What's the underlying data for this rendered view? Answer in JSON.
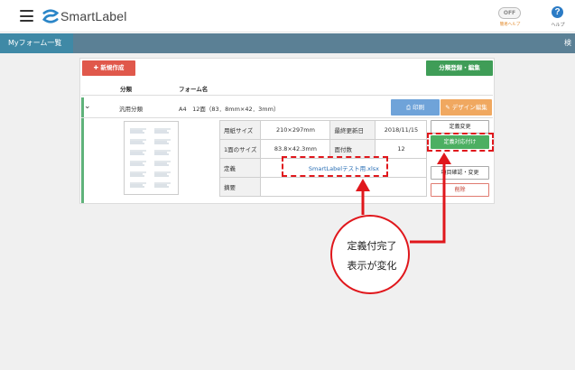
{
  "header": {
    "brand": "SmartLabel",
    "toggle_state": "OFF",
    "toggle_caption": "簡易ヘルプ",
    "help_label": "ヘルプ"
  },
  "nav": {
    "active_tab": "Myフォーム一覧",
    "right_text": "検"
  },
  "toolbar": {
    "new_button": "✚ 新規作成",
    "category_button": "分類登録・編集"
  },
  "columns": {
    "category": "分類",
    "form_name": "フォーム名"
  },
  "row": {
    "category": "汎用分類",
    "form_name": "A4　12面（83．8mm×42．3mm）",
    "print_button": "印刷",
    "design_button": "デザイン編集"
  },
  "details": {
    "paper_size_label": "用紙サイズ",
    "paper_size_value": "210×297mm",
    "last_updated_label": "最終更新日",
    "last_updated_value": "2018/11/15",
    "piece_size_label": "1面のサイズ",
    "piece_size_value": "83.8×42.3mm",
    "count_label": "面付数",
    "count_value": "12",
    "definition_label": "定義",
    "definition_value": "SmartLabelテスト用.xlsx",
    "summary_label": "摘要",
    "summary_value": ""
  },
  "side_buttons": {
    "change_definition": "定義変更",
    "assoc_definition": "定義対応付け",
    "confirm_change": "項目確認・変更",
    "delete": "削除"
  },
  "annotation": {
    "line1": "定義付完了",
    "line2": "表示が変化"
  },
  "colors": {
    "nav_bar": "#5b8095",
    "nav_active": "#3f89a6",
    "new_button": "#e0584b",
    "category_button": "#3f9d57",
    "print_button": "#6fa3d9",
    "design_button": "#f0a860",
    "assoc_button": "#4caf62",
    "annotation_red": "#e0171c"
  },
  "icons": {
    "menu": "hamburger-icon",
    "help": "question-circle-icon",
    "print": "printer-icon",
    "design": "edit-icon",
    "expand": "chevron-down-icon"
  }
}
